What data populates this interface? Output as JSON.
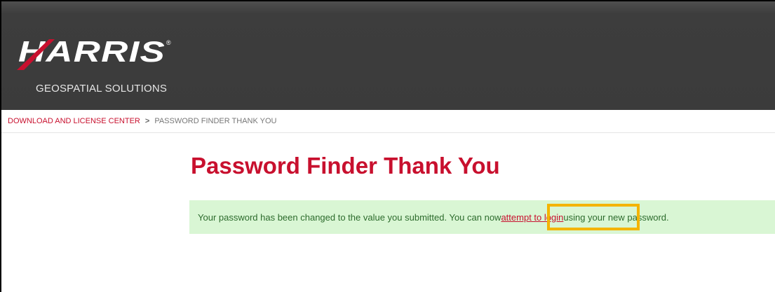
{
  "header": {
    "logo_text": "HARRIS",
    "tagline": "GEOSPATIAL SOLUTIONS",
    "brand_color": "#c8102e"
  },
  "breadcrumb": {
    "link_label": "DOWNLOAD AND LICENSE CENTER",
    "separator": ">",
    "current": "PASSWORD FINDER THANK YOU"
  },
  "main": {
    "title": "Password Finder Thank You",
    "message_before": "Your password has been changed to the value you submitted. You can now ",
    "link_label": "attempt to login",
    "message_after": " using your new password."
  },
  "highlight_color": "#f4b400"
}
